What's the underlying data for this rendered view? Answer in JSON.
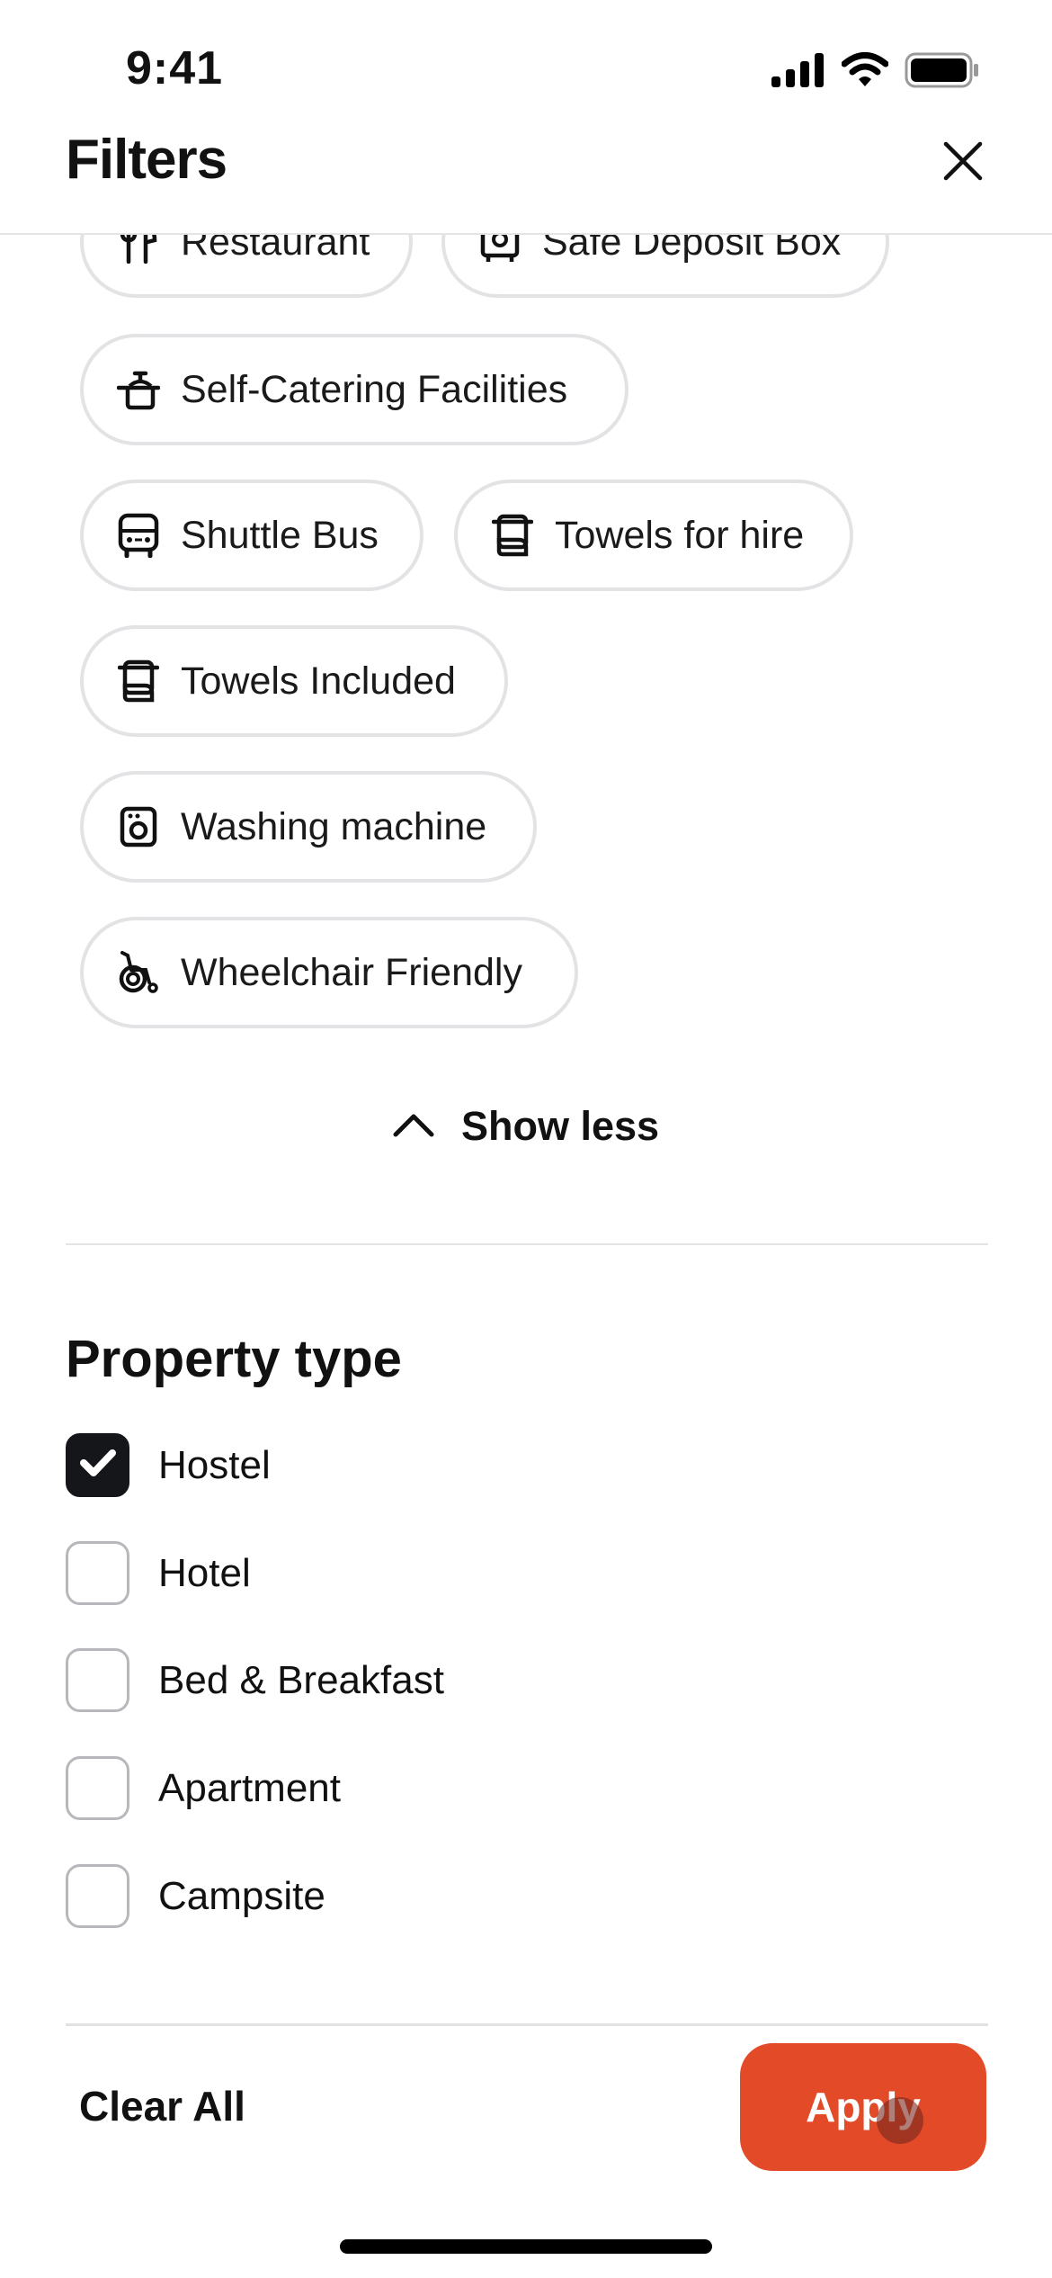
{
  "status_bar": {
    "time": "9:41",
    "icons": [
      "signal-icon",
      "wifi-icon",
      "battery-icon"
    ]
  },
  "header": {
    "title": "Filters",
    "close_icon": "close-icon"
  },
  "facilities": {
    "chips": [
      {
        "label": "Restaurant",
        "icon": "fork-knife-icon"
      },
      {
        "label": "Safe Deposit Box",
        "icon": "safe-icon"
      },
      {
        "label": "Self-Catering Facilities",
        "icon": "cooking-pot-icon"
      },
      {
        "label": "Shuttle Bus",
        "icon": "bus-icon"
      },
      {
        "label": "Towels for hire",
        "icon": "towel-icon"
      },
      {
        "label": "Towels Included",
        "icon": "towel-icon"
      },
      {
        "label": "Washing machine",
        "icon": "washing-machine-icon"
      },
      {
        "label": "Wheelchair Friendly",
        "icon": "wheelchair-icon"
      }
    ],
    "toggle_label": "Show less"
  },
  "property_type": {
    "title": "Property type",
    "options": [
      {
        "label": "Hostel",
        "checked": true
      },
      {
        "label": "Hotel",
        "checked": false
      },
      {
        "label": "Bed & Breakfast",
        "checked": false
      },
      {
        "label": "Apartment",
        "checked": false
      },
      {
        "label": "Campsite",
        "checked": false
      }
    ]
  },
  "footer": {
    "clear_label": "Clear All",
    "apply_label": "Apply",
    "apply_color": "#e24a28"
  }
}
